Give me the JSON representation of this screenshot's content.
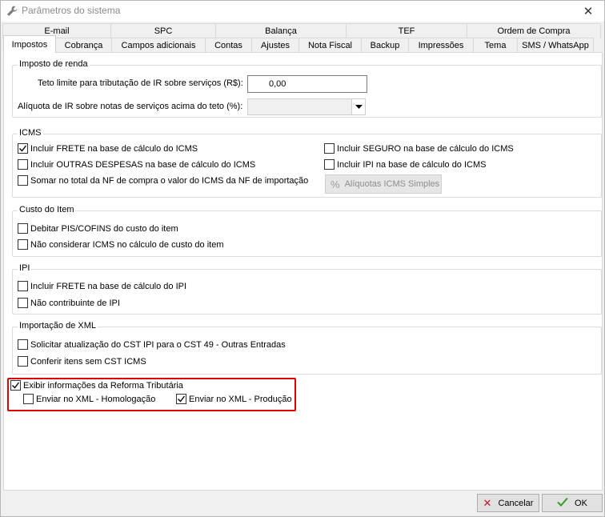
{
  "window": {
    "title": "Parâmetros do sistema"
  },
  "tabs_top": [
    "E-mail",
    "SPC",
    "Balança",
    "TEF",
    "Ordem de Compra"
  ],
  "tabs_bottom": [
    "Impostos",
    "Cobrança",
    "Campos adicionais",
    "Contas",
    "Ajustes",
    "Nota Fiscal",
    "Backup",
    "Impressões",
    "Tema",
    "SMS / WhatsApp"
  ],
  "active_tab": "Impostos",
  "imposto_renda": {
    "label": "Imposto de renda",
    "teto_label": "Teto limite para tributação de IR sobre serviços (R$):",
    "teto_value": "0,00",
    "aliquota_label": "Alíquota de IR sobre notas de serviços acima do teto (%):",
    "aliquota_value": ""
  },
  "icms": {
    "label": "ICMS",
    "frete": {
      "label": "Incluir FRETE na base de cálculo do ICMS",
      "checked": true
    },
    "outras_despesas": {
      "label": "Incluir OUTRAS DESPESAS na base de cálculo do ICMS",
      "checked": false
    },
    "somar_importacao": {
      "label": "Somar no total da NF de compra o valor do ICMS da NF de importação",
      "checked": false
    },
    "seguro": {
      "label": "Incluir SEGURO na base de cálculo do ICMS",
      "checked": false
    },
    "ipi": {
      "label": "Incluir IPI na base de cálculo do ICMS",
      "checked": false
    },
    "aliquotas_button": "Alíquotas ICMS Simples"
  },
  "custo_item": {
    "label": "Custo do Item",
    "debitar": {
      "label": "Debitar PIS/COFINS do custo do item",
      "checked": false
    },
    "nao_considerar": {
      "label": "Não considerar ICMS no cálculo de custo do item",
      "checked": false
    }
  },
  "ipi": {
    "label": "IPI",
    "frete": {
      "label": "Incluir FRETE na base de cálculo do IPI",
      "checked": false
    },
    "nao_contribuinte": {
      "label": "Não contribuinte de IPI",
      "checked": false
    }
  },
  "importacao_xml": {
    "label": "Importação de XML",
    "solicitar": {
      "label": "Solicitar atualização do CST IPI para o CST 49 - Outras Entradas",
      "checked": false
    },
    "conferir": {
      "label": "Conferir itens sem CST ICMS",
      "checked": false
    }
  },
  "reforma": {
    "exibir": {
      "label": "Exibir informações da Reforma Tributária",
      "checked": true
    },
    "homologacao": {
      "label": "Enviar no XML - Homologação",
      "checked": false
    },
    "producao": {
      "label": "Enviar no XML - Produção",
      "checked": true
    }
  },
  "footer": {
    "cancel": "Cancelar",
    "ok": "OK"
  },
  "colors": {
    "highlight": "#e00000",
    "ok_check": "#3a9a2a",
    "cancel_x": "#c8102e"
  }
}
